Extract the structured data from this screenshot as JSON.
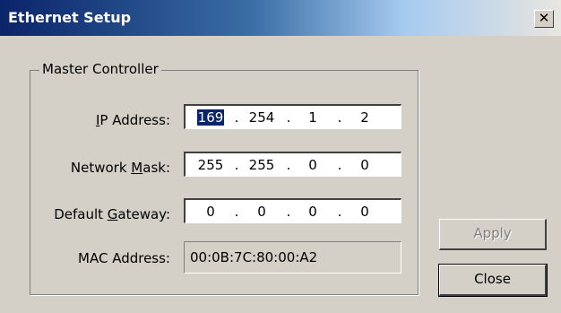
{
  "window": {
    "title": "Ethernet Setup",
    "close_glyph": "✕"
  },
  "group": {
    "label": "Master Controller"
  },
  "fields": {
    "ip": {
      "label_mn": "I",
      "label_rest": "P Address:",
      "octets": [
        "169",
        "254",
        "1",
        "2"
      ],
      "selected_octet": 0
    },
    "mask": {
      "label_pre": "Network ",
      "label_mn": "M",
      "label_rest": "ask:",
      "octets": [
        "255",
        "255",
        "0",
        "0"
      ]
    },
    "gateway": {
      "label_pre": "Default ",
      "label_mn": "G",
      "label_rest": "ateway:",
      "octets": [
        "0",
        "0",
        "0",
        "0"
      ]
    },
    "mac": {
      "label": "MAC Address:",
      "value": "00:0B:7C:80:00:A2"
    }
  },
  "buttons": {
    "apply": {
      "label": "Apply",
      "enabled": false
    },
    "close": {
      "label": "Close",
      "enabled": true
    }
  },
  "colors": {
    "title_bar_start": "#0a246a",
    "selection": "#0a246a",
    "face": "#d4d0c8"
  }
}
